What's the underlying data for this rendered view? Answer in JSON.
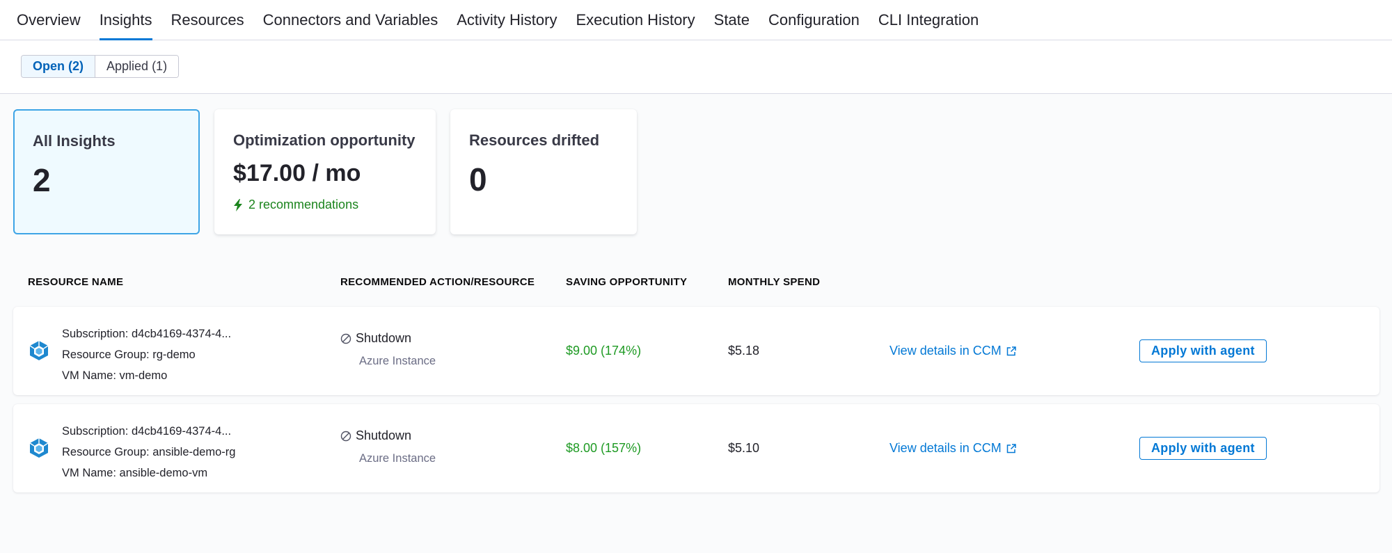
{
  "nav": {
    "tabs": [
      {
        "label": "Overview",
        "active": false
      },
      {
        "label": "Insights",
        "active": true
      },
      {
        "label": "Resources",
        "active": false
      },
      {
        "label": "Connectors and Variables",
        "active": false
      },
      {
        "label": "Activity History",
        "active": false
      },
      {
        "label": "Execution History",
        "active": false
      },
      {
        "label": "State",
        "active": false
      },
      {
        "label": "Configuration",
        "active": false
      },
      {
        "label": "CLI Integration",
        "active": false
      }
    ]
  },
  "filter": {
    "open_label": "Open (2)",
    "applied_label": "Applied (1)",
    "selected": "open"
  },
  "cards": {
    "all_insights": {
      "title": "All Insights",
      "value": "2"
    },
    "optimization": {
      "title": "Optimization opportunity",
      "value": "$17.00 / mo",
      "recommendations": "2 recommendations"
    },
    "drifted": {
      "title": "Resources drifted",
      "value": "0"
    }
  },
  "table": {
    "headers": {
      "resource_name": "RESOURCE NAME",
      "recommended_action": "RECOMMENDED ACTION/RESOURCE",
      "saving": "SAVING OPPORTUNITY",
      "monthly_spend": "MONTHLY SPEND"
    },
    "rows": [
      {
        "subscription": "Subscription: d4cb4169-4374-4...",
        "resource_group": "Resource Group: rg-demo",
        "vm_name": "VM Name: vm-demo",
        "action": "Shutdown",
        "resource_type": "Azure Instance",
        "saving": "$9.00 (174%)",
        "spend": "$5.18",
        "details_link": "View details in CCM",
        "apply_label": "Apply with agent"
      },
      {
        "subscription": "Subscription: d4cb4169-4374-4...",
        "resource_group": "Resource Group: ansible-demo-rg",
        "vm_name": "VM Name: ansible-demo-vm",
        "action": "Shutdown",
        "resource_type": "Azure Instance",
        "saving": "$8.00 (157%)",
        "spend": "$5.10",
        "details_link": "View details in CCM",
        "apply_label": "Apply with agent"
      }
    ]
  },
  "icons": {
    "vm": "azure-vm-icon",
    "action": "prohibit-icon",
    "recommendation": "lightning-icon",
    "external": "external-link-icon"
  },
  "colors": {
    "accent": "#0278d5",
    "saving": "#1e9a23",
    "selected_card_bg": "#effaff",
    "selected_card_border": "#3da4e6"
  }
}
